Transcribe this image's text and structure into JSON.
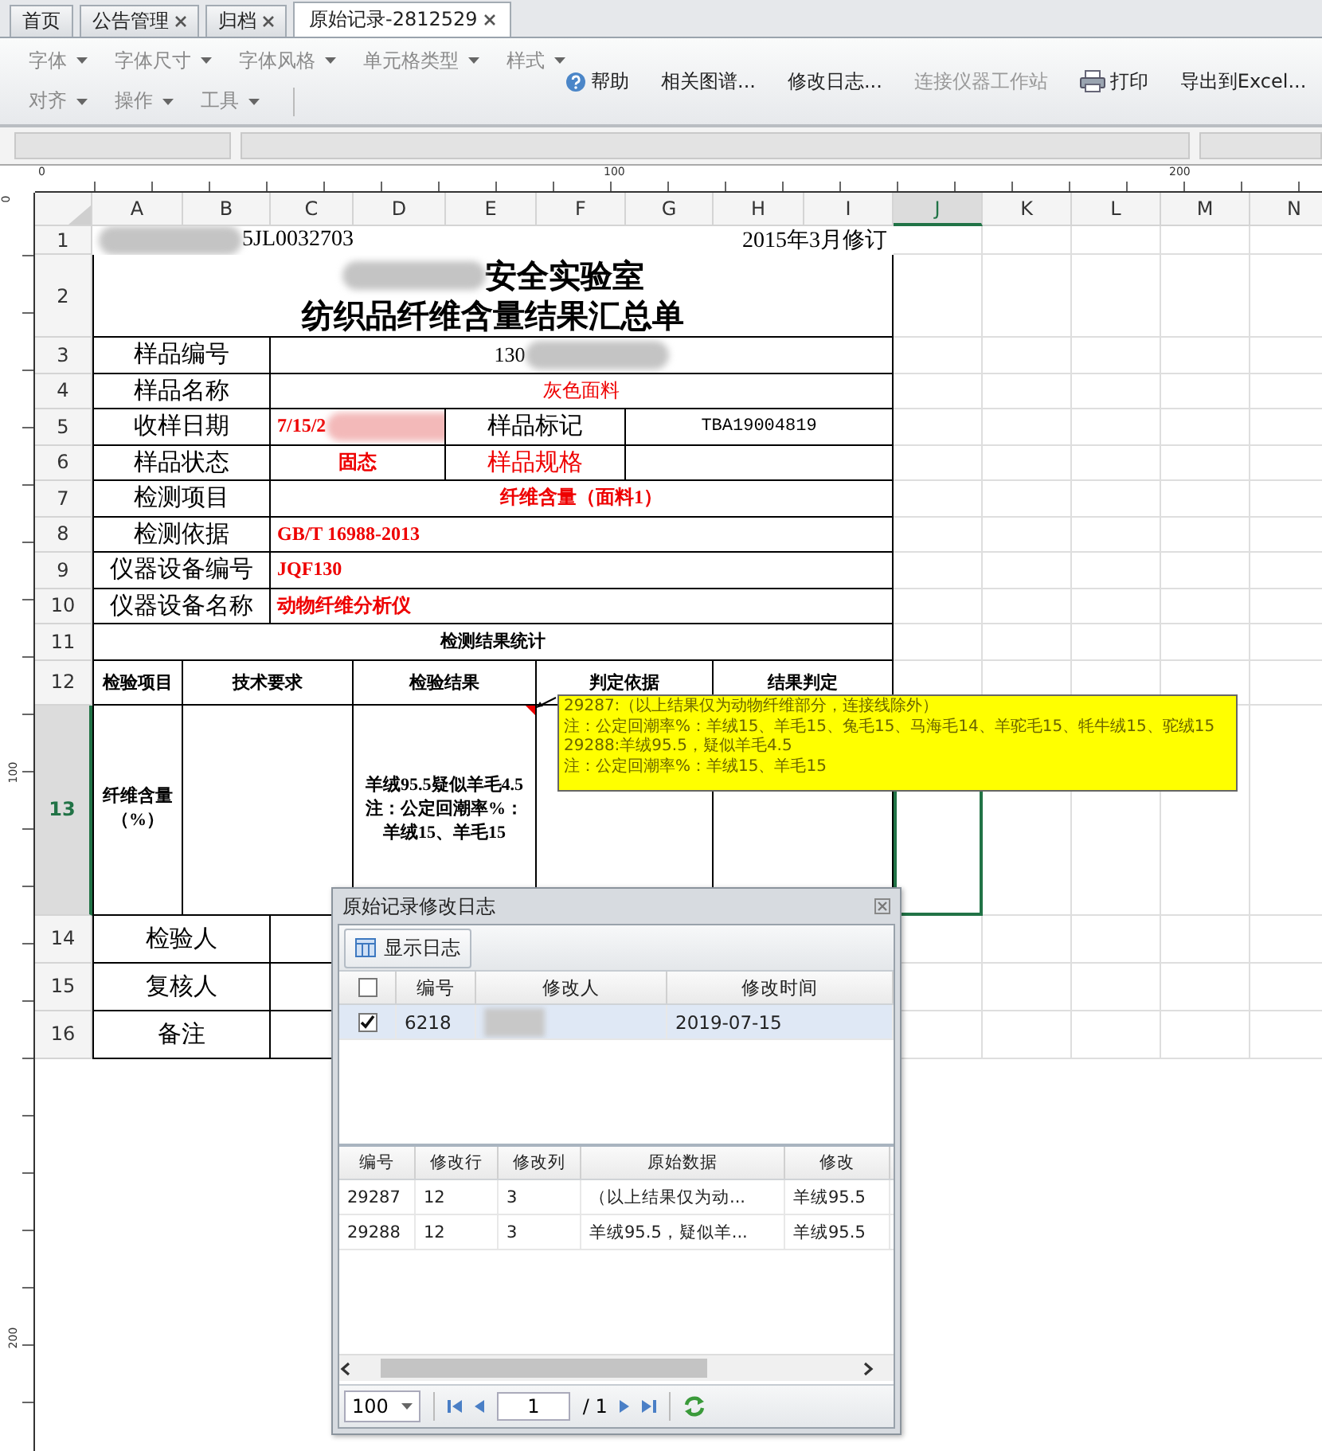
{
  "tabs": [
    {
      "label": "首页",
      "closable": false,
      "selected": false
    },
    {
      "label": "公告管理",
      "closable": true,
      "selected": false
    },
    {
      "label": "归档",
      "closable": true,
      "selected": false
    },
    {
      "label": "原始记录-2812529",
      "closable": true,
      "selected": true
    }
  ],
  "toolbar": {
    "menu_rows": [
      [
        {
          "label": "字体",
          "disabled": true
        },
        {
          "label": "字体尺寸",
          "disabled": true
        },
        {
          "label": "字体风格",
          "disabled": true
        },
        {
          "label": "单元格类型",
          "disabled": true
        },
        {
          "label": "样式",
          "disabled": true
        }
      ],
      [
        {
          "label": "对齐",
          "disabled": true
        },
        {
          "label": "操作",
          "disabled": true
        },
        {
          "label": "工具",
          "disabled": true
        }
      ]
    ],
    "actions": [
      {
        "label": "帮助",
        "kind": "help",
        "disabled": false
      },
      {
        "label": "相关图谱...",
        "kind": "text",
        "disabled": false
      },
      {
        "label": "修改日志...",
        "kind": "text",
        "disabled": false
      },
      {
        "label": "连接仪器工作站",
        "kind": "text",
        "disabled": true
      },
      {
        "label": "打印",
        "kind": "print",
        "disabled": false
      },
      {
        "label": "导出到Excel...",
        "kind": "text",
        "disabled": false
      }
    ]
  },
  "ruler": {
    "labels": [
      "0",
      "100",
      "200"
    ]
  },
  "vertical_ruler": {
    "labels": [
      "0",
      "100",
      "200"
    ]
  },
  "column_headers": [
    {
      "label": "A",
      "selected": false
    },
    {
      "label": "B",
      "selected": false
    },
    {
      "label": "C",
      "selected": false
    },
    {
      "label": "D",
      "selected": false
    },
    {
      "label": "E",
      "selected": false
    },
    {
      "label": "F",
      "selected": false
    },
    {
      "label": "G",
      "selected": false
    },
    {
      "label": "H",
      "selected": false
    },
    {
      "label": "I",
      "selected": false
    },
    {
      "label": "J",
      "selected": true
    },
    {
      "label": "K",
      "selected": false
    },
    {
      "label": "L",
      "selected": false
    },
    {
      "label": "M",
      "selected": false
    },
    {
      "label": "N",
      "selected": false
    }
  ],
  "sheet": {
    "header_rows": [
      {
        "number": "1",
        "selected": false,
        "cells": [
          {
            "kind": "plain",
            "text": "5JL0032703",
            "right_text": "2015年3月修订",
            "redacted_before": true
          }
        ]
      },
      {
        "number": "2",
        "selected": false,
        "cells": [
          {
            "kind": "title",
            "lines": [
              "安全实验室",
              "纺织品纤维含量结果汇总单"
            ],
            "redacted_before": true
          }
        ]
      }
    ],
    "info_rows": [
      {
        "number": "3",
        "selected": false,
        "cells": [
          {
            "kind": "label",
            "text": "样品编号"
          },
          {
            "kind": "value",
            "text": "130",
            "redacted_after": true
          }
        ]
      },
      {
        "number": "4",
        "selected": false,
        "cells": [
          {
            "kind": "label",
            "text": "样品名称"
          },
          {
            "kind": "red",
            "text": "灰色面料"
          }
        ]
      },
      {
        "number": "5",
        "selected": false,
        "cells": [
          {
            "kind": "label",
            "text": "收样日期"
          },
          {
            "kind": "red-bold-left",
            "text": "7/15/2",
            "redacted_after": true
          },
          {
            "kind": "label",
            "text": "样品标记"
          },
          {
            "kind": "mono",
            "text": "TBA19004819"
          }
        ]
      },
      {
        "number": "6",
        "selected": false,
        "cells": [
          {
            "kind": "label",
            "text": "样品状态"
          },
          {
            "kind": "red-bold",
            "text": "固态"
          },
          {
            "kind": "red-label",
            "text": "样品规格"
          },
          {
            "kind": "blank"
          }
        ]
      },
      {
        "number": "7",
        "selected": false,
        "cells": [
          {
            "kind": "label",
            "text": "检测项目"
          },
          {
            "kind": "red-bold",
            "text": "纤维含量（面料1）"
          }
        ]
      },
      {
        "number": "8",
        "selected": false,
        "cells": [
          {
            "kind": "label",
            "text": "检测依据"
          },
          {
            "kind": "red-bold-left",
            "text": "GB/T 16988-2013"
          }
        ]
      },
      {
        "number": "9",
        "selected": false,
        "cells": [
          {
            "kind": "label",
            "text": "仪器设备编号"
          },
          {
            "kind": "red-bold-left",
            "text": "JQF130"
          }
        ]
      },
      {
        "number": "10",
        "selected": false,
        "cells": [
          {
            "kind": "label",
            "text": "仪器设备名称"
          },
          {
            "kind": "red-bold-left",
            "text": "动物纤维分析仪"
          }
        ]
      }
    ],
    "result_rows": [
      {
        "number": "11",
        "selected": false,
        "cells": [
          {
            "kind": "heading",
            "text": "检测结果统计"
          }
        ]
      },
      {
        "number": "12",
        "selected": false,
        "cells": [
          {
            "kind": "heading",
            "text": "检验项目"
          },
          {
            "kind": "heading",
            "text": "技术要求"
          },
          {
            "kind": "heading",
            "text": "检验结果"
          },
          {
            "kind": "heading",
            "text": "判定依据"
          },
          {
            "kind": "heading",
            "text": "结果判定"
          }
        ]
      },
      {
        "number": "13",
        "selected": true,
        "cells": [
          {
            "kind": "bold-multi",
            "lines": [
              "纤维含量",
              "（%）"
            ]
          },
          {
            "kind": "blank"
          },
          {
            "kind": "bold-multi",
            "lines": [
              "羊绒95.5疑似羊毛4.5",
              "注：公定回潮率%：羊绒15、羊毛15"
            ],
            "comment": true
          },
          {
            "kind": "blank"
          },
          {
            "kind": "blank"
          }
        ]
      }
    ],
    "sign_rows": [
      {
        "number": "14",
        "selected": false,
        "cells": [
          {
            "kind": "label",
            "text": "检验人"
          },
          {
            "kind": "blank"
          }
        ]
      },
      {
        "number": "15",
        "selected": false,
        "cells": [
          {
            "kind": "label",
            "text": "复核人"
          },
          {
            "kind": "blank"
          }
        ]
      },
      {
        "number": "16",
        "selected": false,
        "cells": [
          {
            "kind": "label",
            "text": "备注"
          },
          {
            "kind": "blank"
          }
        ]
      }
    ]
  },
  "comment": {
    "lines": [
      "29287:（以上结果仅为动物纤维部分，连接线除外）",
      "注：公定回潮率%：羊绒15、羊毛15、兔毛15、马海毛14、羊驼毛15、牦牛绒15、驼绒15",
      "29288:羊绒95.5，疑似羊毛4.5",
      "注：公定回潮率%：羊绒15、羊毛15"
    ]
  },
  "log_dialog": {
    "title": "原始记录修改日志",
    "show_button": "显示日志",
    "upper_grid": {
      "header_checked": false,
      "columns": [
        "编号",
        "修改人",
        "修改时间"
      ],
      "rows": [
        {
          "checked": true,
          "selected": true,
          "number": "6218",
          "editor_redacted": true,
          "time": "2019-07-15"
        }
      ]
    },
    "lower_grid": {
      "columns": [
        "编号",
        "修改行",
        "修改列",
        "原始数据",
        "修改"
      ],
      "rows": [
        {
          "cells": [
            "29287",
            "12",
            "3",
            "（以上结果仅为动...",
            "羊绒95.5"
          ]
        },
        {
          "cells": [
            "29288",
            "12",
            "3",
            "羊绒95.5，疑似羊...",
            "羊绒95.5"
          ]
        }
      ]
    },
    "pager": {
      "page_size": "100",
      "page": "1",
      "total": "/ 1"
    }
  }
}
